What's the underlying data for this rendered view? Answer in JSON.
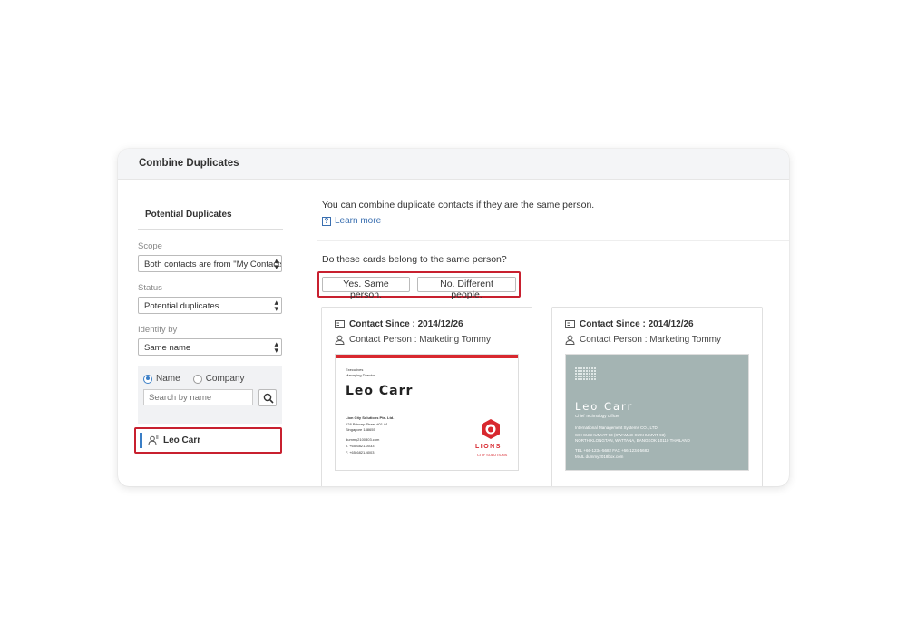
{
  "window": {
    "title": "Combine Duplicates"
  },
  "sidebar": {
    "tab": "Potential Duplicates",
    "scope": {
      "label": "Scope",
      "value": "Both contacts are from \"My Contacts\""
    },
    "status": {
      "label": "Status",
      "value": "Potential duplicates"
    },
    "identify": {
      "label": "Identify by",
      "value": "Same name"
    },
    "search": {
      "option_name": "Name",
      "option_company": "Company",
      "selected": "Name",
      "placeholder": "Search by name"
    },
    "result": {
      "name": "Leo Carr"
    }
  },
  "main": {
    "intro": "You can combine duplicate contacts if they are the same person.",
    "learn_more": "Learn more",
    "question": "Do these cards belong to the same person?",
    "yes_label": "Yes. Same person.",
    "no_label": "No. Different people."
  },
  "cards": [
    {
      "contact_since": "Contact Since : 2014/12/26",
      "contact_person": "Contact Person : Marketing Tommy",
      "card": {
        "dept": "Executives",
        "title": "Managing Director",
        "name": "Leo Carr",
        "company": "Lion City Solutions Pte. Ltd.",
        "address1": "128 Princep Street #01-01",
        "address2": "Singapore 188655",
        "email": "dummy2100803.com",
        "tel": "T. +65-6821-0033",
        "fax": "F. +65-6821-4003",
        "logo_text": "LIONS",
        "logo_sub": "CITY SOLUTIONS",
        "accent": "#d8282f"
      }
    },
    {
      "contact_since": "Contact Since : 2014/12/26",
      "contact_person": "Contact Person : Marketing Tommy",
      "card": {
        "name": "Leo Carr",
        "title": "Chief Technology Officer",
        "company": "International Management Systems CO., LTD.",
        "address1": "SOI SUKHUMVIT 93 (SWAMAE SUKHUMVIT 93)",
        "address2": "NORTH KLONGTAN, WATTANA, BANGKOK 10110 THAILAND",
        "tel": "TEL  +66-1234-5682      FAX  +66-1234-5682",
        "mail": "MAIL  dummy2018box.com",
        "background": "#a4b4b3"
      }
    }
  ],
  "colors": {
    "highlight": "#c8202f",
    "accent_blue": "#3a7ec6",
    "link": "#3a6fb0"
  }
}
